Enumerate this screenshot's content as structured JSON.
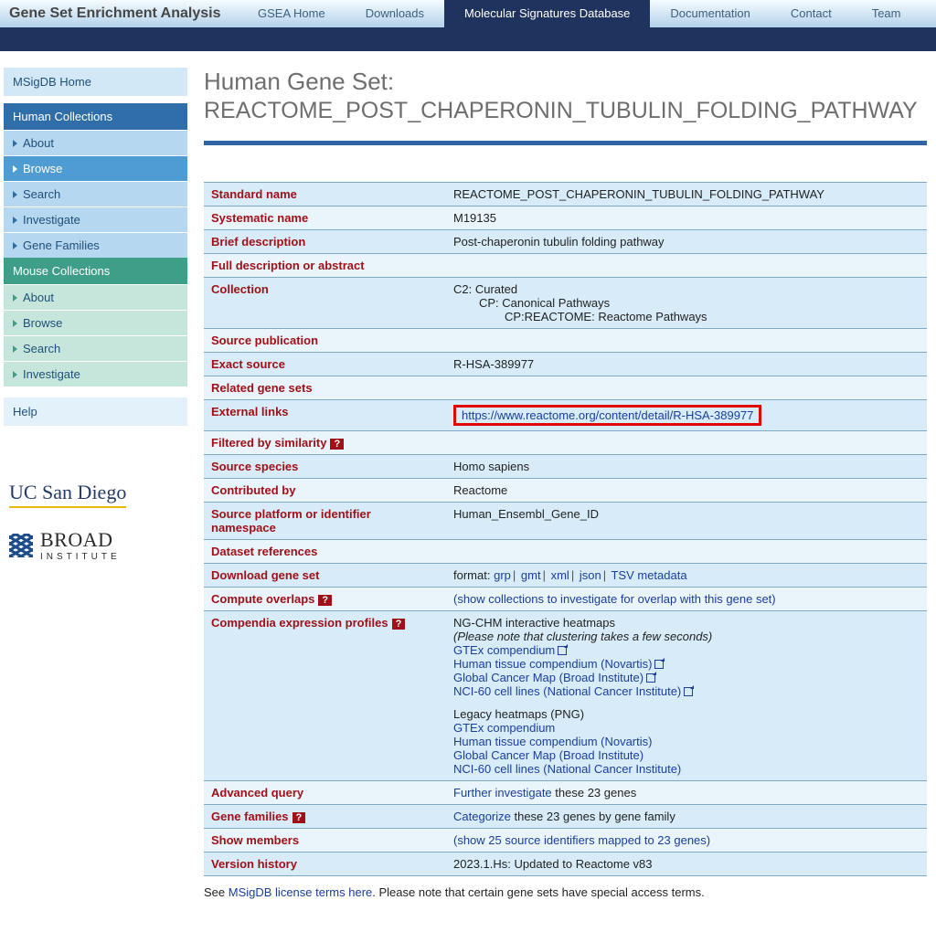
{
  "header": {
    "site_logo": "Gene Set Enrichment Analysis",
    "tabs": [
      "GSEA Home",
      "Downloads",
      "Molecular Signatures Database",
      "Documentation",
      "Contact",
      "Team"
    ],
    "active_tab_index": 2
  },
  "sidebar": {
    "home": "MSigDB Home",
    "human_header": "Human Collections",
    "human_items": [
      "About",
      "Browse",
      "Search",
      "Investigate",
      "Gene Families"
    ],
    "human_active_index": 1,
    "mouse_header": "Mouse Collections",
    "mouse_items": [
      "About",
      "Browse",
      "Search",
      "Investigate"
    ],
    "help": "Help",
    "brand_ucsd": "UC San Diego",
    "brand_broad_1": "BROAD",
    "brand_broad_2": "INSTITUTE"
  },
  "page": {
    "kicker": "Human Gene Set:",
    "title": "REACTOME_POST_CHAPERONIN_TUBULIN_FOLDING_PATHWAY"
  },
  "details": {
    "standard_name": {
      "label": "Standard name",
      "value": "REACTOME_POST_CHAPERONIN_TUBULIN_FOLDING_PATHWAY"
    },
    "systematic_name": {
      "label": "Systematic name",
      "value": "M19135"
    },
    "brief_description": {
      "label": "Brief description",
      "value": "Post-chaperonin tubulin folding pathway"
    },
    "full_description": {
      "label": "Full description or abstract",
      "value": ""
    },
    "collection": {
      "label": "Collection",
      "line1": "C2: Curated",
      "line2": "CP: Canonical Pathways",
      "line3": "CP:REACTOME: Reactome Pathways"
    },
    "source_publication": {
      "label": "Source publication",
      "value": ""
    },
    "exact_source": {
      "label": "Exact source",
      "value": "R-HSA-389977"
    },
    "related_gene_sets": {
      "label": "Related gene sets",
      "value": ""
    },
    "external_links": {
      "label": "External links",
      "url": "https://www.reactome.org/content/detail/R-HSA-389977"
    },
    "filtered_by_similarity": {
      "label": "Filtered by similarity",
      "value": ""
    },
    "source_species": {
      "label": "Source species",
      "value": "Homo sapiens"
    },
    "contributed_by": {
      "label": "Contributed by",
      "value": "Reactome"
    },
    "source_platform": {
      "label": "Source platform or identifier namespace",
      "value": "Human_Ensembl_Gene_ID"
    },
    "dataset_references": {
      "label": "Dataset references",
      "value": ""
    },
    "download": {
      "label": "Download gene set",
      "prefix": "format:",
      "formats": [
        "grp",
        "gmt",
        "xml",
        "json",
        "TSV metadata"
      ]
    },
    "compute_overlaps": {
      "label": "Compute overlaps",
      "link": "(show collections to investigate for overlap with this gene set)"
    },
    "compendia": {
      "label": "Compendia expression profiles",
      "ngchm_title": "NG-CHM interactive heatmaps",
      "note": "(Please note that clustering takes a few seconds)",
      "interactive": [
        "GTEx compendium",
        "Human tissue compendium (Novartis)",
        "Global Cancer Map (Broad Institute)",
        "NCI-60 cell lines (National Cancer Institute)"
      ],
      "legacy_title": "Legacy heatmaps (PNG)",
      "legacy": [
        "GTEx compendium",
        "Human tissue compendium (Novartis)",
        "Global Cancer Map (Broad Institute)",
        "NCI-60 cell lines (National Cancer Institute)"
      ]
    },
    "advanced_query": {
      "label": "Advanced query",
      "link": "Further investigate",
      "suffix": " these 23 genes"
    },
    "gene_families": {
      "label": "Gene families",
      "link": "Categorize",
      "suffix": " these 23 genes by gene family"
    },
    "show_members": {
      "label": "Show members",
      "link": "(show 25 source identifiers mapped to 23 genes)"
    },
    "version_history": {
      "label": "Version history",
      "value": "2023.1.Hs: Updated to Reactome v83"
    }
  },
  "footnote": {
    "prefix": "See ",
    "link": "MSigDB license terms here",
    "suffix": ". Please note that certain gene sets have special access terms."
  },
  "glyphs": {
    "qmark": "?",
    "pipe": "|"
  }
}
